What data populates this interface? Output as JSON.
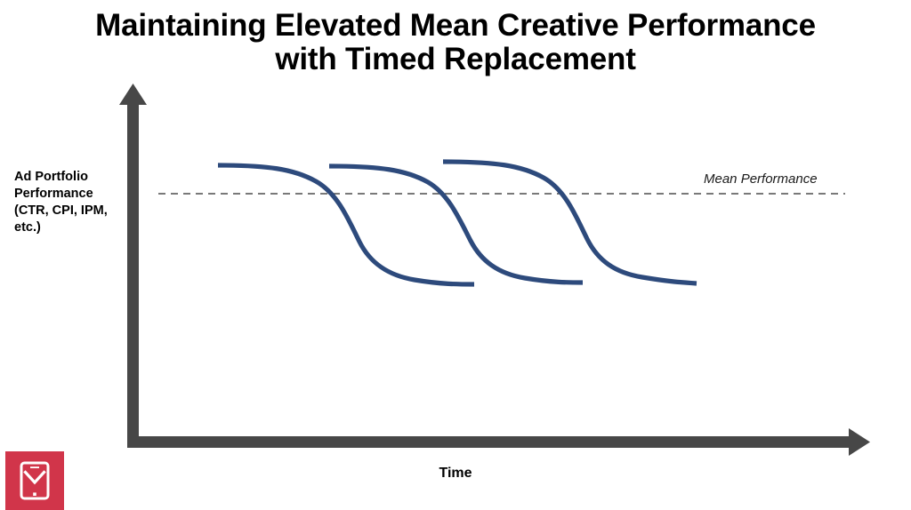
{
  "slide": {
    "background_color": "#ffffff",
    "title_lines": [
      "Maintaining Elevated Mean Creative Performance",
      "with Timed Replacement"
    ]
  },
  "axes": {
    "y_label_lines": [
      "Ad Portfolio",
      "Performance",
      "(CTR, CPI, IPM,",
      "etc.)"
    ],
    "x_label": "Time",
    "axis_color": "#474747"
  },
  "annotations": {
    "mean_performance_label": "Mean Performance",
    "mean_line_color": "#4d4d4d"
  },
  "logo": {
    "name": "phone-chevron-logo",
    "background_color": "#d1354a",
    "mark_color": "#ffffff"
  },
  "chart_data": {
    "type": "line",
    "title": "Maintaining Elevated Mean Creative Performance with Timed Replacement",
    "xlabel": "Time",
    "ylabel": "Ad Portfolio Performance (CTR, CPI, IPM, etc.)",
    "grid": false,
    "legend_position": "none",
    "axis_arrows": true,
    "xlim": [
      0,
      100
    ],
    "ylim": [
      0,
      100
    ],
    "xticks": [],
    "yticks": [],
    "series_color": "#2d4a7c",
    "reference_lines": [
      {
        "name": "Mean Performance",
        "y": 62,
        "style": "dashed",
        "color": "#4d4d4d",
        "label": "Mean Performance",
        "x_start": 3,
        "x_end": 97
      }
    ],
    "series": [
      {
        "name": "Creative 1 decay curve",
        "shape": "sigmoid-decay",
        "x": [
          11.5,
          19,
          26,
          32,
          36,
          40,
          44,
          48,
          52,
          56,
          60
        ],
        "y": [
          78,
          77.5,
          76,
          73,
          68,
          58,
          46,
          38,
          34,
          31.5,
          30
        ],
        "plateau_high": 78,
        "plateau_low": 30,
        "inflection_x": 40
      },
      {
        "name": "Creative 2 decay curve",
        "shape": "sigmoid-decay",
        "x": [
          26.5,
          34,
          41,
          47,
          51,
          55,
          59,
          63,
          67,
          71,
          75
        ],
        "y": [
          77.7,
          77.2,
          75.5,
          72.5,
          67.5,
          57.5,
          45.5,
          37.5,
          33.5,
          31.2,
          30.3
        ],
        "plateau_high": 77.7,
        "plateau_low": 30.3,
        "inflection_x": 55
      },
      {
        "name": "Creative 3 decay curve",
        "shape": "sigmoid-decay",
        "x": [
          42,
          49.5,
          56.5,
          62.5,
          66.5,
          70.5,
          74.5,
          78.5,
          82.5,
          86.5,
          90.5
        ],
        "y": [
          79,
          78.5,
          77,
          74,
          69,
          59,
          47,
          39,
          35,
          32.5,
          31
        ],
        "plateau_high": 79,
        "plateau_low": 31,
        "inflection_x": 70.5
      }
    ]
  }
}
